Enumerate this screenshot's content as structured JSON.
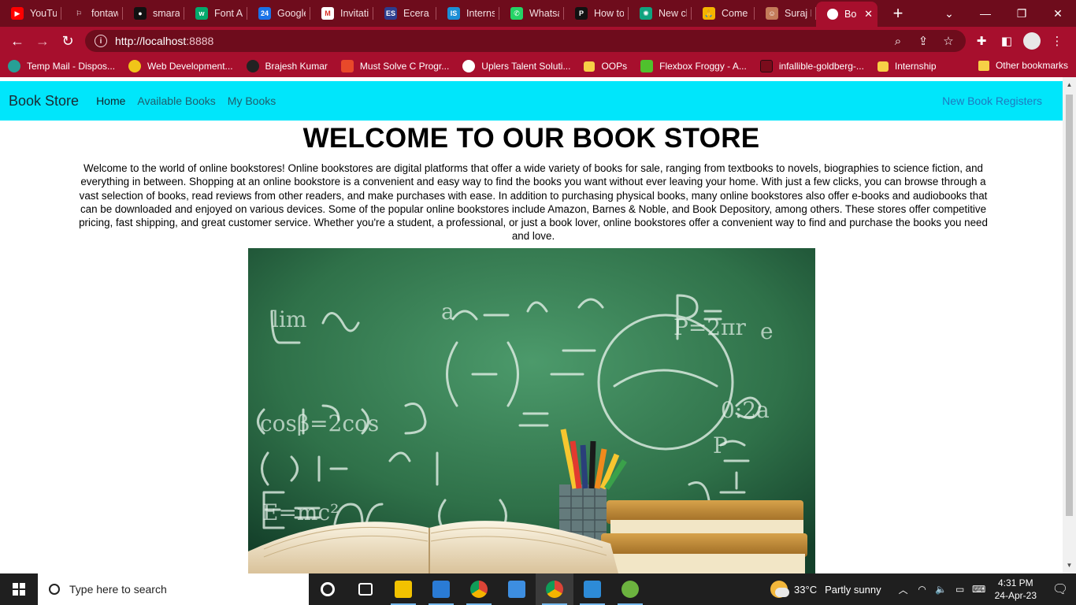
{
  "browser": {
    "tabs": [
      {
        "label": "YouTub",
        "icon": "youtube-icon",
        "color": "#ff0000",
        "glyph": "▶"
      },
      {
        "label": "fontaw",
        "icon": "flag-icon",
        "color": "#6e0c1c",
        "glyph": "⚐"
      },
      {
        "label": "smaran",
        "icon": "github-icon",
        "color": "#111111",
        "glyph": "●"
      },
      {
        "label": "Font A",
        "icon": "w3schools-icon",
        "color": "#04aa6d",
        "glyph": "w"
      },
      {
        "label": "Google",
        "icon": "google-calendar-icon",
        "color": "#1a73e8",
        "glyph": "24"
      },
      {
        "label": "Invitati",
        "icon": "gmail-icon",
        "color": "#ffffff",
        "glyph": "M"
      },
      {
        "label": "Ecera S",
        "icon": "ecera-icon",
        "color": "#2c3e8f",
        "glyph": "ES"
      },
      {
        "label": "Interns",
        "icon": "internshala-icon",
        "color": "#1b8fd6",
        "glyph": "IS"
      },
      {
        "label": "Whatsa",
        "icon": "whatsapp-icon",
        "color": "#25d366",
        "glyph": "✆"
      },
      {
        "label": "How to",
        "icon": "pagefault-icon",
        "color": "#111111",
        "glyph": "P"
      },
      {
        "label": "New ch",
        "icon": "chatgpt-icon",
        "color": "#10a37f",
        "glyph": "✺"
      },
      {
        "label": "Come",
        "icon": "pray-icon",
        "color": "#f4b400",
        "glyph": "🙏"
      },
      {
        "label": "Suraj P",
        "icon": "profile-icon",
        "color": "#c47b5a",
        "glyph": "☺"
      }
    ],
    "active_tab": {
      "label": "Boo",
      "close": "✕"
    },
    "new_tab": "+",
    "url": "http://localhost",
    "url_port": ":8888",
    "bookmarks": [
      {
        "label": "Temp Mail - Dispos...",
        "icon": "tempmail-icon",
        "color": "#27a096"
      },
      {
        "label": "Web Development...",
        "icon": "webdev-icon",
        "color": "#f0c419"
      },
      {
        "label": "Brajesh Kumar",
        "icon": "brajesh-icon",
        "color": "#222222"
      },
      {
        "label": "Must Solve C Progr...",
        "icon": "c-programs-icon",
        "color": "#e8492a"
      },
      {
        "label": "Uplers Talent Soluti...",
        "icon": "globe-icon",
        "color": "#ffffff"
      },
      {
        "label": "OOPs",
        "icon": "folder-icon",
        "color": "#f7d046"
      },
      {
        "label": "Flexbox Froggy - A...",
        "icon": "frog-icon",
        "color": "#4fc12d"
      },
      {
        "label": "infallible-goldberg-...",
        "icon": "netlify-icon",
        "color": "#7a0c1c"
      },
      {
        "label": "Internship",
        "icon": "folder-icon",
        "color": "#f7d046"
      }
    ],
    "other_bookmarks": "Other bookmarks"
  },
  "site": {
    "brand": "Book Store",
    "nav": [
      "Home",
      "Available Books",
      "My Books"
    ],
    "nav_right": "New Book Registers",
    "heading": "WELCOME TO OUR BOOK STORE",
    "intro": "Welcome to the world of online bookstores! Online bookstores are digital platforms that offer a wide variety of books for sale, ranging from textbooks to novels, biographies to science fiction, and everything in between. Shopping at an online bookstore is a convenient and easy way to find the books you want without ever leaving your home. With just a few clicks, you can browse through a vast selection of books, read reviews from other readers, and make purchases with ease. In addition to purchasing physical books, many online bookstores also offer e-books and audiobooks that can be downloaded and enjoyed on various devices. Some of the popular online bookstores include Amazon, Barnes & Noble, and Book Depository, among others. These stores offer competitive pricing, fast shipping, and great customer service. Whether you're a student, a professional, or just a book lover, online bookstores offer a convenient way to find and purchase the books you need and love."
  },
  "taskbar": {
    "search_placeholder": "Type here to search",
    "apps": [
      {
        "name": "cortana-icon",
        "color": "#ffffff"
      },
      {
        "name": "task-view-icon",
        "color": "#ffffff"
      },
      {
        "name": "file-explorer-icon",
        "color": "#f2c200"
      },
      {
        "name": "mail-icon",
        "color": "#2a7bd5"
      },
      {
        "name": "chrome-icon",
        "color": "#db4437"
      },
      {
        "name": "store-icon",
        "color": "#3d8ee0"
      },
      {
        "name": "chrome-profile-icon",
        "color": "#db4437"
      },
      {
        "name": "vscode-icon",
        "color": "#2d8bd7"
      },
      {
        "name": "spring-tool-icon",
        "color": "#6cb33f"
      }
    ],
    "weather_temp": "33°C",
    "weather_desc": "Partly sunny",
    "time": "4:31 PM",
    "date": "24-Apr-23"
  }
}
